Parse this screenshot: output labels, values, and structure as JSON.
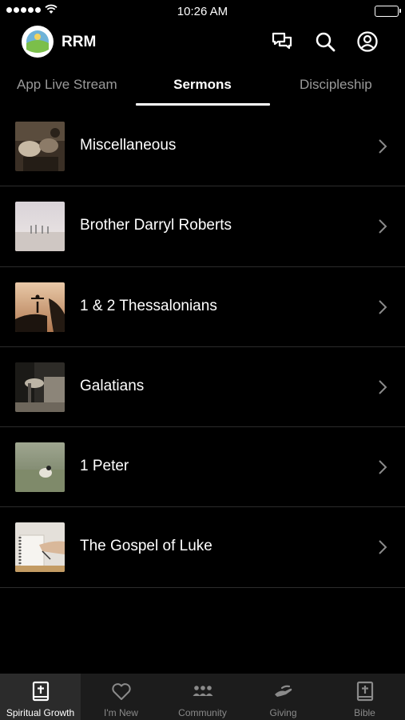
{
  "status_bar": {
    "time": "10:26 AM"
  },
  "header": {
    "app_title": "RRM",
    "icons": [
      "chat-icon",
      "search-icon",
      "profile-icon"
    ]
  },
  "tabs": [
    {
      "label": "App Live Stream",
      "active": false
    },
    {
      "label": "Sermons",
      "active": true
    },
    {
      "label": "Discipleship",
      "active": false
    }
  ],
  "sermon_series": [
    {
      "label": "Miscellaneous"
    },
    {
      "label": "Brother Darryl Roberts"
    },
    {
      "label": "1 & 2 Thessalonians"
    },
    {
      "label": "Galatians"
    },
    {
      "label": "1 Peter"
    },
    {
      "label": "The Gospel of Luke"
    }
  ],
  "bottom_nav": [
    {
      "label": "Spiritual Growth",
      "icon": "bible-icon",
      "active": true
    },
    {
      "label": "I'm New",
      "icon": "heart-icon",
      "active": false
    },
    {
      "label": "Community",
      "icon": "people-icon",
      "active": false
    },
    {
      "label": "Giving",
      "icon": "giving-hand-icon",
      "active": false
    },
    {
      "label": "Bible",
      "icon": "bible-icon",
      "active": false
    }
  ],
  "colors": {
    "background": "#000000",
    "nav_background": "#1c1c1c",
    "inactive_text": "#9a9a9a",
    "divider": "#2c2c2c"
  }
}
